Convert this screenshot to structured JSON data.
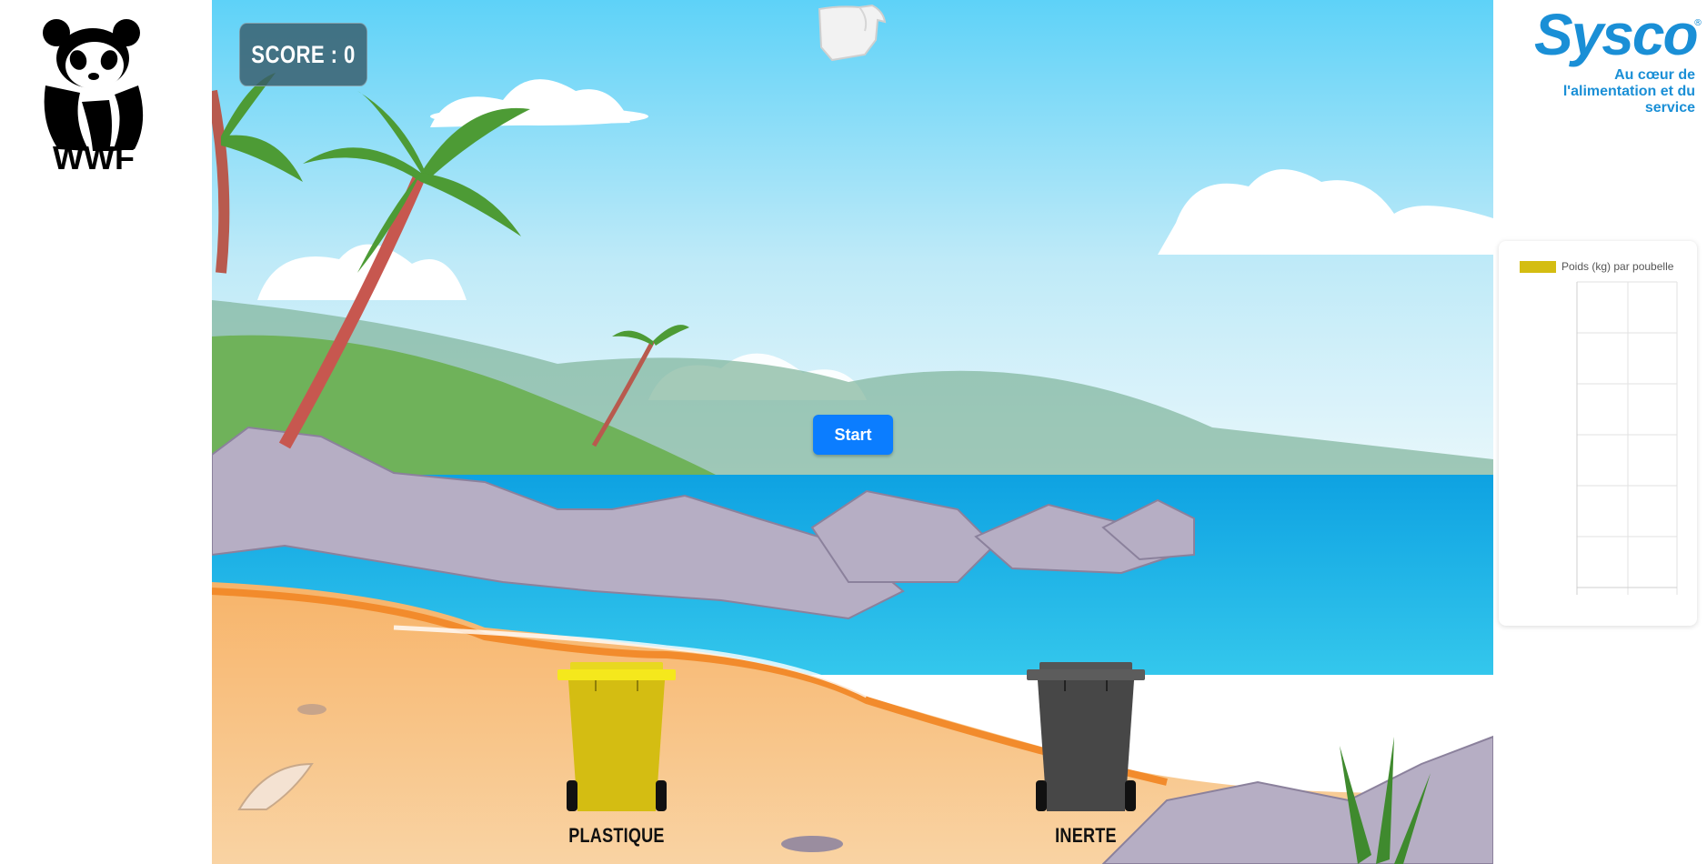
{
  "score": {
    "label": "SCORE : 0"
  },
  "start_button": {
    "label": "Start"
  },
  "bins": [
    {
      "id": "plastique",
      "label": "PLASTIQUE",
      "color": "#d4bd12",
      "lid_color": "#f5e81c"
    },
    {
      "id": "inerte",
      "label": "INERTE",
      "color": "#474747",
      "lid_color": "#5c5c5c"
    }
  ],
  "left_logo": {
    "name": "wwf-logo",
    "text": "WWF"
  },
  "right_logo": {
    "name": "sysco-logo",
    "text": "Sysco",
    "tagline": "Au cœur de l'alimentation et du service",
    "color": "#1a8fd6"
  },
  "chart_data": {
    "type": "bar",
    "legend": [
      {
        "name": "Poids (kg) par poubelle",
        "color": "#d4bd12"
      }
    ],
    "series": [
      {
        "name": "Poids (kg) par poubelle",
        "values": []
      }
    ],
    "categories": [],
    "grid": true,
    "legend_position": "top"
  },
  "falling_item": {
    "name": "plastic-bag-icon"
  },
  "colors": {
    "sky_top": "#5fd3f7",
    "sea": "#12b5e8",
    "sand": "#f6c78d",
    "start": "#0b7dff"
  }
}
